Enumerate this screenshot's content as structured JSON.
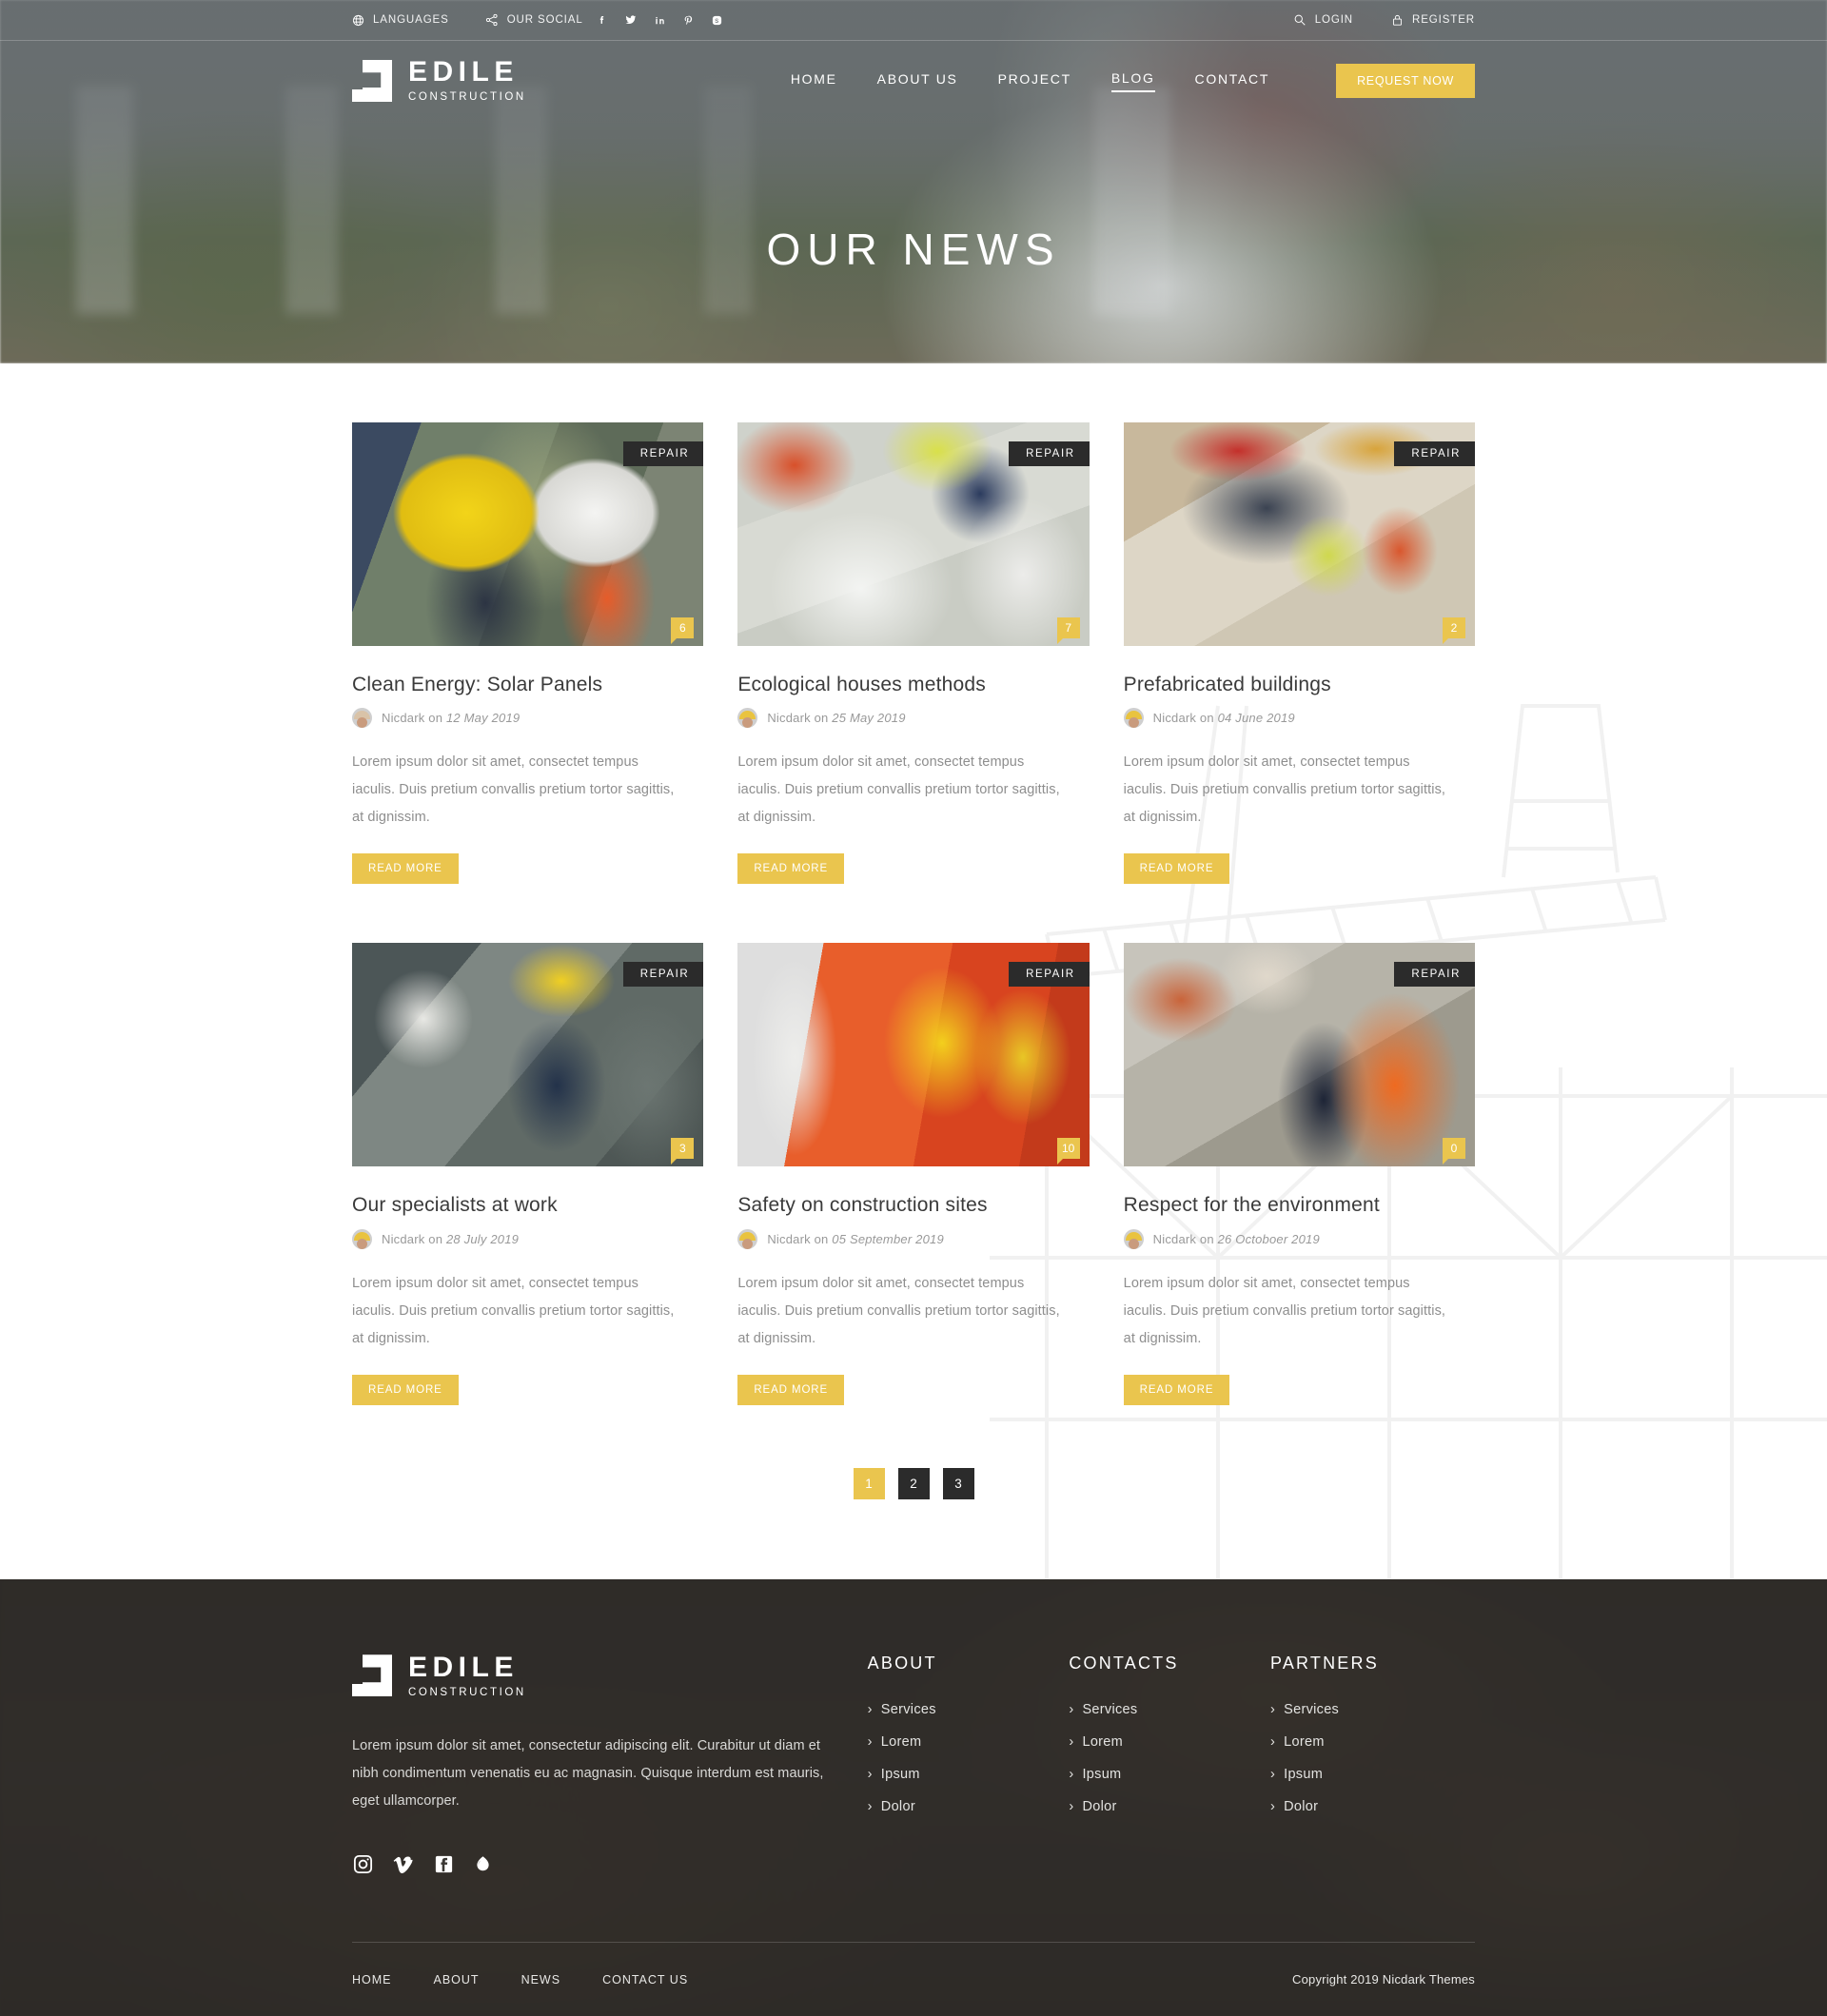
{
  "topbar": {
    "languages_label": "LANGUAGES",
    "social_label": "OUR SOCIAL",
    "socials": [
      "facebook-icon",
      "twitter-icon",
      "linkedin-icon",
      "pinterest-icon",
      "skype-icon"
    ],
    "login_label": "LOGIN",
    "register_label": "REGISTER"
  },
  "brand": {
    "name": "EDILE",
    "tagline": "CONSTRUCTION"
  },
  "nav": {
    "items": [
      {
        "label": "HOME",
        "active": false
      },
      {
        "label": "ABOUT US",
        "active": false
      },
      {
        "label": "PROJECT",
        "active": false
      },
      {
        "label": "BLOG",
        "active": true
      },
      {
        "label": "CONTACT",
        "active": false
      }
    ],
    "cta_label": "REQUEST NOW"
  },
  "hero": {
    "title": "OUR NEWS"
  },
  "posts": [
    {
      "category": "REPAIR",
      "comments": "6",
      "title": "Clean Energy: Solar Panels",
      "author": "Nicdark on",
      "date": "12 May 2019",
      "excerpt": "Lorem ipsum dolor sit amet, consectet tempus iaculis. Duis pretium convallis pretium tortor sagittis, at dignissim.",
      "read_more": "READ MORE"
    },
    {
      "category": "REPAIR",
      "comments": "7",
      "title": "Ecological houses methods",
      "author": "Nicdark on",
      "date": "25 May 2019",
      "excerpt": "Lorem ipsum dolor sit amet, consectet tempus iaculis. Duis pretium convallis pretium tortor sagittis, at dignissim.",
      "read_more": "READ MORE"
    },
    {
      "category": "REPAIR",
      "comments": "2",
      "title": "Prefabricated buildings",
      "author": "Nicdark on",
      "date": "04 June 2019",
      "excerpt": "Lorem ipsum dolor sit amet, consectet tempus iaculis. Duis pretium convallis pretium tortor sagittis, at dignissim.",
      "read_more": "READ MORE"
    },
    {
      "category": "REPAIR",
      "comments": "3",
      "title": "Our specialists at work",
      "author": "Nicdark on",
      "date": "28 July 2019",
      "excerpt": "Lorem ipsum dolor sit amet, consectet tempus iaculis. Duis pretium convallis pretium tortor sagittis, at dignissim.",
      "read_more": "READ MORE"
    },
    {
      "category": "REPAIR",
      "comments": "10",
      "title": "Safety on construction sites",
      "author": "Nicdark on",
      "date": "05 September 2019",
      "excerpt": "Lorem ipsum dolor sit amet, consectet tempus iaculis. Duis pretium convallis pretium tortor sagittis, at dignissim.",
      "read_more": "READ MORE"
    },
    {
      "category": "REPAIR",
      "comments": "0",
      "title": "Respect for the environment",
      "author": "Nicdark on",
      "date": "26 Octoboer 2019",
      "excerpt": "Lorem ipsum dolor sit amet, consectet tempus iaculis. Duis pretium convallis pretium tortor sagittis, at dignissim.",
      "read_more": "READ MORE"
    }
  ],
  "pagination": {
    "pages": [
      "1",
      "2",
      "3"
    ],
    "active": "1"
  },
  "footer": {
    "description": "Lorem ipsum dolor sit amet, consectetur adipiscing elit. Curabitur ut diam et nibh condimentum venenatis eu ac magnasin. Quisque interdum est mauris, eget ullamcorper.",
    "socials": [
      "instagram-icon",
      "vimeo-icon",
      "facebook-icon",
      "dribbble-icon"
    ],
    "columns": [
      {
        "title": "ABOUT",
        "links": [
          "Services",
          "Lorem",
          "Ipsum",
          "Dolor"
        ]
      },
      {
        "title": "CONTACTS",
        "links": [
          "Services",
          "Lorem",
          "Ipsum",
          "Dolor"
        ]
      },
      {
        "title": "PARTNERS",
        "links": [
          "Services",
          "Lorem",
          "Ipsum",
          "Dolor"
        ]
      }
    ],
    "bottom_links": [
      "HOME",
      "ABOUT",
      "NEWS",
      "CONTACT US"
    ],
    "copyright": "Copyright 2019 Nicdark Themes"
  },
  "colors": {
    "accent": "#eac54e",
    "dark": "#2b2b2b",
    "footer_bg": "#3a3733"
  }
}
